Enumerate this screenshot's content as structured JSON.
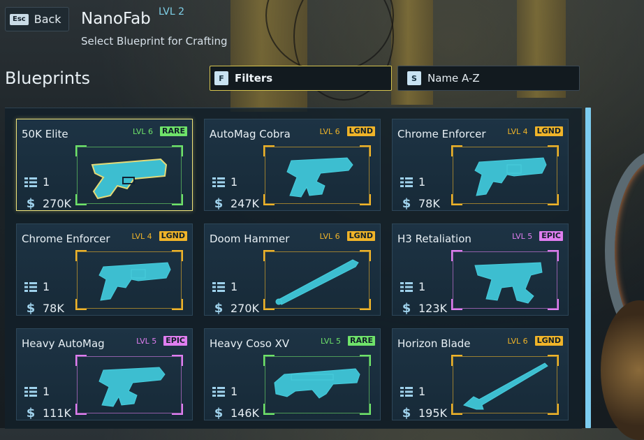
{
  "header": {
    "back_key": "Esc",
    "back_label": "Back",
    "title": "NanoFab",
    "title_level": "LVL 2",
    "subtitle": "Select Blueprint for Crafting"
  },
  "section_title": "Blueprints",
  "toolbar": {
    "filter_key": "F",
    "filter_label": "Filters",
    "sort_key": "S",
    "sort_label": "Name A-Z"
  },
  "rarity_colors": {
    "RARE": "#6fe36a",
    "LGND": "#f0b429",
    "EPIC": "#e07ef0"
  },
  "blueprints": [
    {
      "name": "50K Elite",
      "level": "LVL 6",
      "rarity": "RARE",
      "qty": "1",
      "price": "270K",
      "icon": "pistol-icon",
      "selected": true
    },
    {
      "name": "AutoMag Cobra",
      "level": "LVL 6",
      "rarity": "LGND",
      "qty": "1",
      "price": "247K",
      "icon": "automag-icon"
    },
    {
      "name": "Chrome Enforcer",
      "level": "LVL 4",
      "rarity": "LGND",
      "qty": "1",
      "price": "78K",
      "icon": "revolver-icon"
    },
    {
      "name": "Chrome Enforcer",
      "level": "LVL 4",
      "rarity": "LGND",
      "qty": "1",
      "price": "78K",
      "icon": "revolver-icon"
    },
    {
      "name": "Doom Hammer",
      "level": "LVL 6",
      "rarity": "LGND",
      "qty": "1",
      "price": "270K",
      "icon": "bat-icon"
    },
    {
      "name": "H3 Retaliation",
      "level": "LVL 5",
      "rarity": "EPIC",
      "qty": "1",
      "price": "123K",
      "icon": "smg-icon"
    },
    {
      "name": "Heavy AutoMag",
      "level": "LVL 5",
      "rarity": "EPIC",
      "qty": "1",
      "price": "111K",
      "icon": "automag-icon"
    },
    {
      "name": "Heavy Coso XV",
      "level": "LVL 5",
      "rarity": "RARE",
      "qty": "1",
      "price": "146K",
      "icon": "shotgun-icon"
    },
    {
      "name": "Horizon Blade",
      "level": "LVL 6",
      "rarity": "LGND",
      "qty": "1",
      "price": "195K",
      "icon": "blade-icon"
    }
  ]
}
